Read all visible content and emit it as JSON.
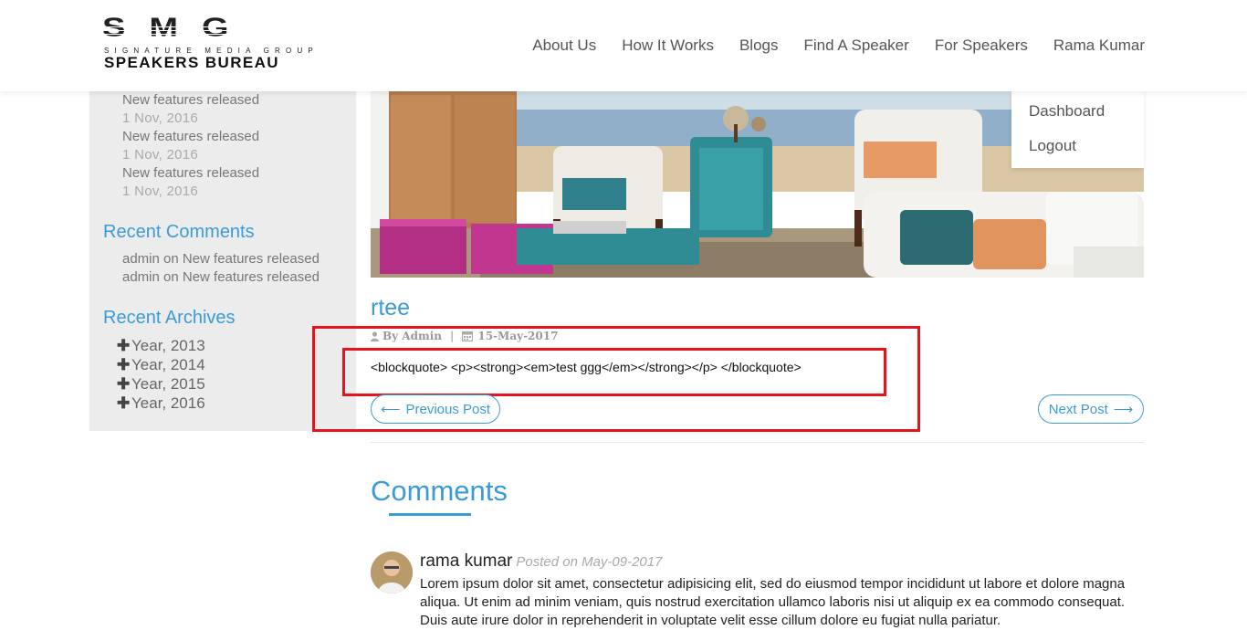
{
  "logo": {
    "big": "SMG",
    "sub": "SIGNATURE MEDIA GROUP",
    "bureau": "SPEAKERS BUREAU"
  },
  "nav": {
    "items": [
      "About Us",
      "How It Works",
      "Blogs",
      "Find A Speaker",
      "For Speakers",
      "Rama Kumar"
    ]
  },
  "user_menu": {
    "dashboard": "Dashboard",
    "logout": "Logout"
  },
  "sidebar": {
    "recent_posts": [
      {
        "title": "New features released",
        "date": "1 Nov, 2016"
      },
      {
        "title": "New features released",
        "date": "1 Nov, 2016"
      },
      {
        "title": "New features released",
        "date": "1 Nov, 2016"
      }
    ],
    "recent_comments_heading": "Recent Comments",
    "recent_comments": [
      "admin on New features released",
      "admin on New features released"
    ],
    "recent_archives_heading": "Recent Archives",
    "archives": [
      "Year, 2013",
      "Year, 2014",
      "Year, 2015",
      "Year, 2016"
    ]
  },
  "post": {
    "title": "rtee",
    "author": "By Admin",
    "date": "15-May-2017",
    "body": "<blockquote> <p><strong><em>test ggg</em></strong></p> </blockquote>",
    "prev_label": "Previous Post",
    "next_label": "Next Post"
  },
  "comments": {
    "heading": "Comments",
    "items": [
      {
        "author": "rama kumar",
        "posted": "Posted on May-09-2017",
        "text": "Lorem ipsum dolor sit amet, consectetur adipisicing elit, sed do eiusmod tempor incididunt ut labore et dolore magna aliqua. Ut enim ad minim veniam, quis nostrud exercitation ullamco laboris nisi ut aliquip ex ea commodo consequat. Duis aute irure dolor in reprehenderit in voluptate velit esse cillum dolore eu fugiat nulla pariatur."
      }
    ]
  },
  "colors": {
    "accent": "#3a9bd9",
    "highlight": "#e8141d"
  }
}
